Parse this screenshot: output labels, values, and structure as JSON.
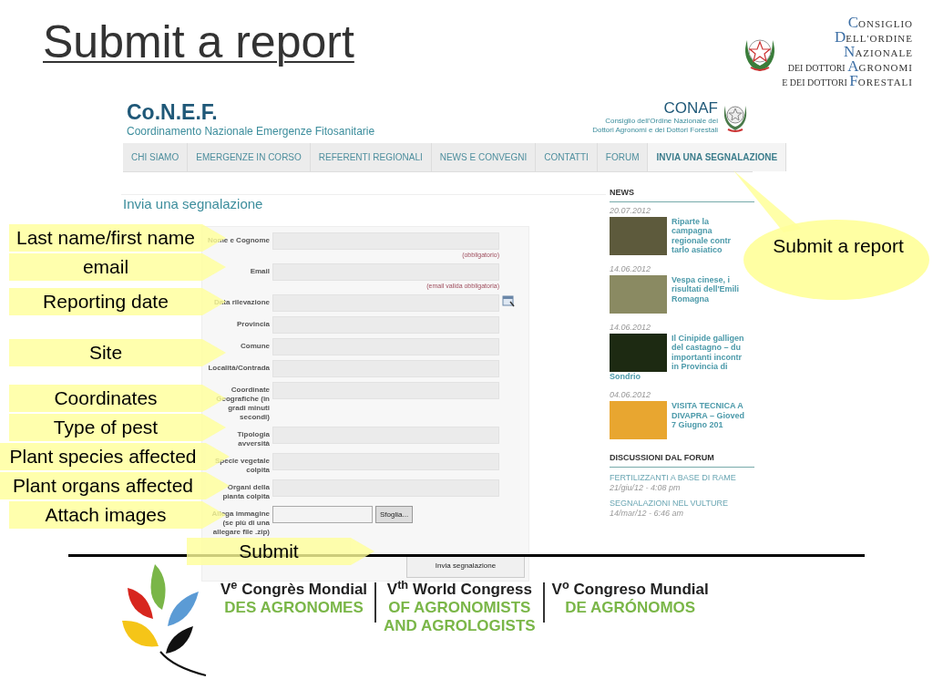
{
  "slide": {
    "title": "Submit a report"
  },
  "logo": {
    "lines": [
      {
        "word": "CONSIGLIO"
      },
      {
        "word": "DELL'ORDINE"
      },
      {
        "word": "NAZIONALE"
      },
      {
        "prefix": "DEI DOTTORI",
        "word": "AGRONOMI"
      },
      {
        "prefix": "E DEI DOTTORI",
        "word": "FORESTALI"
      }
    ]
  },
  "site": {
    "brand": "Co.N.E.F.",
    "tagline": "Coordinamento Nazionale Emergenze Fitosanitarie",
    "partner": {
      "name": "CONAF",
      "lines": [
        "Consiglio dell'Ordine Nazionale dei",
        "Dottori Agronomi e dei Dottori Forestali"
      ]
    },
    "nav": [
      {
        "label": "CHI SIAMO",
        "selected": false
      },
      {
        "label": "EMERGENZE IN CORSO",
        "selected": false
      },
      {
        "label": "REFERENTI REGIONALI",
        "selected": false
      },
      {
        "label": "NEWS E CONVEGNI",
        "selected": false
      },
      {
        "label": "CONTATTI",
        "selected": false
      },
      {
        "label": "FORUM",
        "selected": false
      },
      {
        "label": "INVIA UNA SEGNALAZIONE",
        "selected": true
      }
    ],
    "heading": "Invia una segnalazione",
    "form": {
      "fields": [
        {
          "kind": "text",
          "label": "Nome e Cognome",
          "note": "(obbligatorio)"
        },
        {
          "kind": "text",
          "label": "Email",
          "note": "(email valida obbligatoria)"
        },
        {
          "kind": "date",
          "label": "Data rilevazione"
        },
        {
          "kind": "text",
          "label": "Provincia"
        },
        {
          "kind": "text",
          "label": "Comune"
        },
        {
          "kind": "text",
          "label": "Località/Contrada"
        },
        {
          "kind": "text",
          "label": "Coordinate Geografiche (in gradi minuti secondi)"
        },
        {
          "kind": "text",
          "label": "Tipologia avversità"
        },
        {
          "kind": "text",
          "label": "Specie vegetale colpita"
        },
        {
          "kind": "text",
          "label": "Organi della pianta colpita"
        },
        {
          "kind": "file",
          "label": "Allega immagine (se più di una allegare file .zip)",
          "button": "Sfoglia..."
        }
      ],
      "submit": "Invia segnalazione"
    },
    "news": {
      "title": "NEWS",
      "items": [
        {
          "date": "20.07.2012",
          "lines": [
            "Riparte la",
            "campagna",
            "regionale contr",
            "tarlo asiatico"
          ]
        },
        {
          "date": "14.06.2012",
          "lines": [
            "Vespa cinese, i",
            "risultati dell'Emili",
            "Romagna"
          ]
        },
        {
          "date": "14.06.2012",
          "lines": [
            "Il Cinipide galligen",
            "del castagno – du",
            "importanti incontr",
            "in Provincia di",
            "Sondrio"
          ]
        },
        {
          "date": "04.06.2012",
          "lines": [
            "VISITA TECNICA A",
            "DIVAPRA – Gioved",
            "7 Giugno 201"
          ]
        }
      ]
    },
    "forum": {
      "title": "DISCUSSIONI DAL FORUM",
      "items": [
        {
          "title": "FERTILIZZANTI A BASE DI RAME",
          "meta": "21/giu/12 - 4:08 pm"
        },
        {
          "title": "SEGNALAZIONI NEL VULTURE",
          "meta": "14/mar/12 - 6:46 am"
        }
      ]
    }
  },
  "callouts": [
    {
      "text": "Last name/first name"
    },
    {
      "text": "email"
    },
    {
      "text": "Reporting date"
    },
    {
      "text": "Site"
    },
    {
      "text": "Coordinates"
    },
    {
      "text": "Type of pest"
    },
    {
      "text": "Plant species affected"
    },
    {
      "text": "Plant organs affected"
    },
    {
      "text": "Attach images"
    },
    {
      "text": "Submit"
    }
  ],
  "bubble": {
    "text": "Submit a report"
  },
  "footer": {
    "columns": [
      {
        "title": "V$^{e}$ Congrès Mondial",
        "lines": [
          "DES AGRONOMES"
        ]
      },
      {
        "title": "V$^{th}$ World Congress",
        "lines": [
          "OF AGRONOMISTS",
          "AND AGROLOGISTS"
        ]
      },
      {
        "title": "V$^{o}$ Congreso Mundial",
        "lines": [
          "DE AGRÓNOMOS"
        ]
      }
    ]
  }
}
